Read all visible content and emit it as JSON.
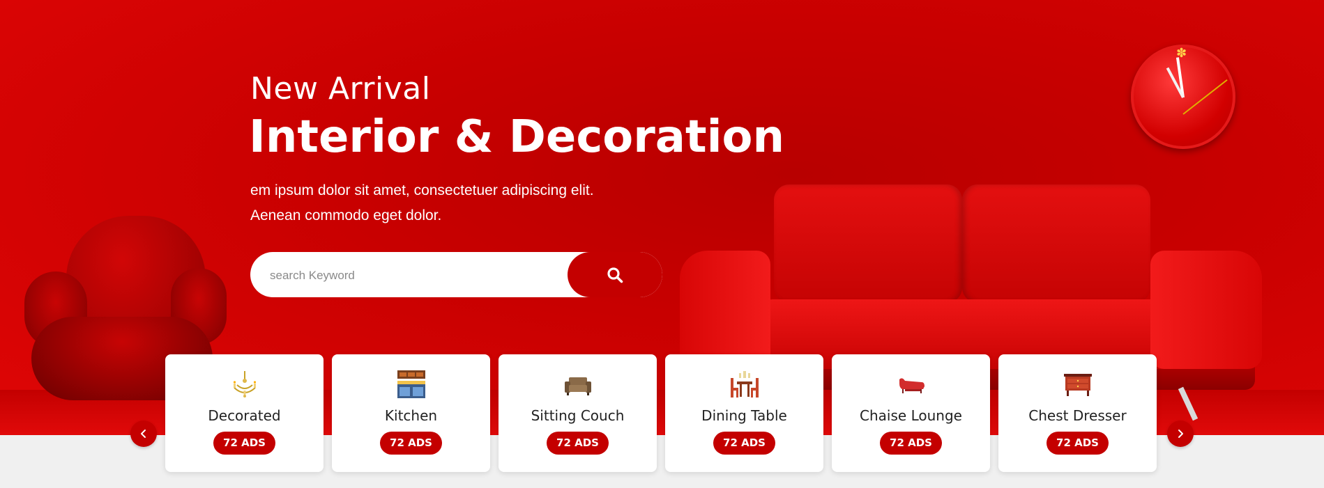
{
  "hero": {
    "subtitle": "New Arrival",
    "title": "Interior & Decoration",
    "desc_line1": "em ipsum dolor sit amet, consectetuer adipiscing elit.",
    "desc_line2": "Aenean commodo eget dolor."
  },
  "search": {
    "placeholder": "search Keyword",
    "value": "",
    "button_icon": "search-icon"
  },
  "categories": [
    {
      "name": "Decorated",
      "badge": "72 ADS",
      "icon": "chandelier-icon"
    },
    {
      "name": "Kitchen",
      "badge": "72 ADS",
      "icon": "kitchen-icon"
    },
    {
      "name": "Sitting Couch",
      "badge": "72 ADS",
      "icon": "couch-icon"
    },
    {
      "name": "Dining Table",
      "badge": "72 ADS",
      "icon": "dining-table-icon"
    },
    {
      "name": "Chaise Lounge",
      "badge": "72 ADS",
      "icon": "chaise-lounge-icon"
    },
    {
      "name": "Chest Dresser",
      "badge": "72 ADS",
      "icon": "dresser-icon"
    }
  ],
  "colors": {
    "accent": "#c40000",
    "hero_bg": "#c80000",
    "page_bg": "#f0f0f0"
  },
  "nav": {
    "prev_icon": "chevron-left-icon",
    "next_icon": "chevron-right-icon"
  }
}
